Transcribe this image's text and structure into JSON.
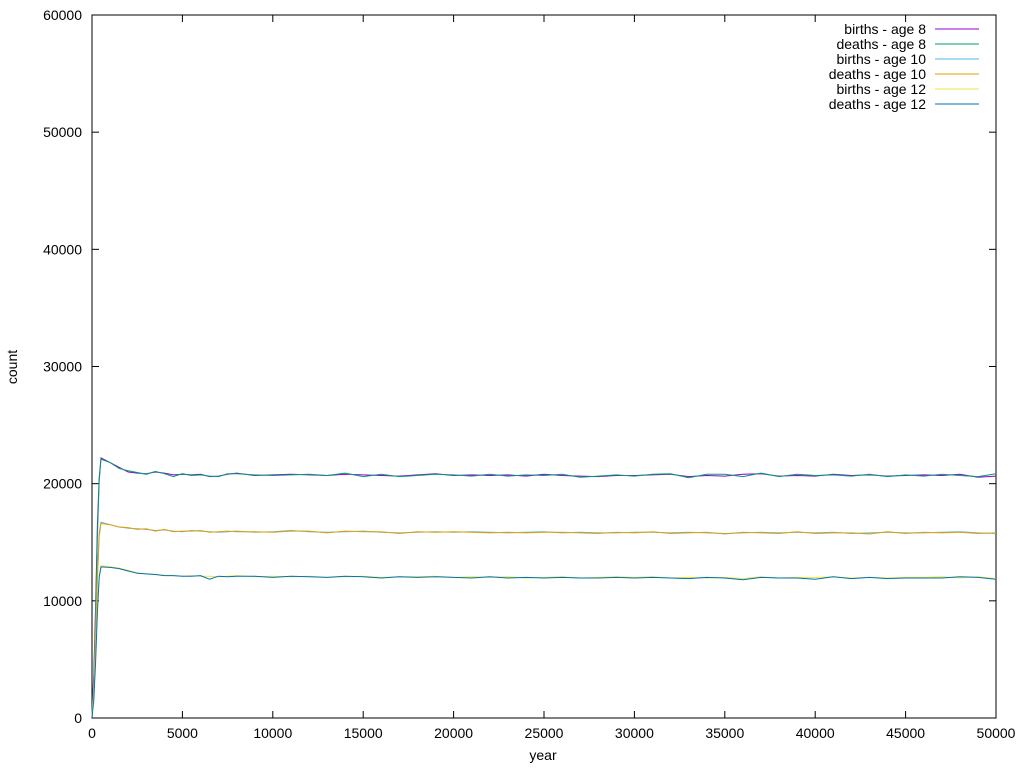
{
  "chart_data": {
    "type": "line",
    "title": "",
    "xlabel": "year",
    "ylabel": "count",
    "xlim": [
      0,
      50000
    ],
    "ylim": [
      0,
      60000
    ],
    "x_ticks": [
      0,
      5000,
      10000,
      15000,
      20000,
      25000,
      30000,
      35000,
      40000,
      45000,
      50000
    ],
    "y_ticks": [
      0,
      10000,
      20000,
      30000,
      40000,
      50000,
      60000
    ],
    "grid": false,
    "legend_position": "top-right",
    "x": [
      0,
      100,
      200,
      300,
      400,
      500,
      1000,
      1500,
      2000,
      2500,
      3000,
      3500,
      4000,
      4500,
      5000,
      5500,
      6000,
      6500,
      7000,
      7500,
      8000,
      9000,
      10000,
      11000,
      12000,
      13000,
      14000,
      15000,
      16000,
      17000,
      18000,
      19000,
      20000,
      21000,
      22000,
      23000,
      24000,
      25000,
      26000,
      27000,
      28000,
      29000,
      30000,
      31000,
      32000,
      33000,
      34000,
      35000,
      36000,
      37000,
      38000,
      39000,
      40000,
      41000,
      42000,
      43000,
      44000,
      45000,
      46000,
      47000,
      48000,
      49000,
      50000
    ],
    "series": [
      {
        "name": "births - age 8",
        "color": "#9400d3",
        "values": [
          200,
          3800,
          9500,
          16500,
          20500,
          22200,
          21800,
          21400,
          21000,
          20900,
          20850,
          21000,
          20900,
          20750,
          20800,
          20750,
          20800,
          20600,
          20650,
          20800,
          20900,
          20700,
          20750,
          20800,
          20750,
          20700,
          20800,
          20750,
          20700,
          20650,
          20750,
          20850,
          20700,
          20750,
          20700,
          20750,
          20650,
          20800,
          20700,
          20650,
          20600,
          20700,
          20700,
          20750,
          20800,
          20600,
          20700,
          20650,
          20800,
          20850,
          20650,
          20700,
          20650,
          20800,
          20700,
          20750,
          20650,
          20700,
          20750,
          20700,
          20800,
          20550,
          20650
        ]
      },
      {
        "name": "deaths - age 8",
        "color": "#009e73",
        "values": [
          100,
          3000,
          8500,
          15500,
          20200,
          22100,
          21800,
          21300,
          21100,
          20950,
          20800,
          21050,
          20850,
          20600,
          20850,
          20700,
          20750,
          20650,
          20600,
          20850,
          20850,
          20750,
          20700,
          20750,
          20800,
          20700,
          20900,
          20600,
          20800,
          20600,
          20700,
          20800,
          20750,
          20650,
          20800,
          20650,
          20750,
          20700,
          20800,
          20550,
          20650,
          20750,
          20650,
          20800,
          20850,
          20500,
          20800,
          20800,
          20600,
          20900,
          20600,
          20800,
          20700,
          20750,
          20650,
          20800,
          20600,
          20750,
          20650,
          20800,
          20700,
          20600,
          20850
        ]
      },
      {
        "name": "births - age 10",
        "color": "#56b4e9",
        "values": [
          150,
          2800,
          7500,
          12500,
          15800,
          16700,
          16500,
          16300,
          16200,
          16150,
          16100,
          16000,
          16050,
          15950,
          15900,
          16000,
          15950,
          15900,
          15850,
          15900,
          15950,
          15850,
          15900,
          16000,
          15900,
          15850,
          15900,
          15950,
          15850,
          15800,
          15850,
          15900,
          15850,
          15900,
          15850,
          15800,
          15850,
          15900,
          15800,
          15850,
          15800,
          15800,
          15850,
          15850,
          15800,
          15850,
          15800,
          15750,
          15800,
          15850,
          15800,
          15850,
          15800,
          15850,
          15750,
          15800,
          15850,
          15800,
          15800,
          15850,
          15900,
          15800,
          15750
        ]
      },
      {
        "name": "deaths - age 10",
        "color": "#e69f00",
        "values": [
          80,
          2200,
          6800,
          11800,
          15500,
          16600,
          16500,
          16300,
          16250,
          16100,
          16150,
          15950,
          16100,
          15900,
          15950,
          15950,
          16000,
          15850,
          15900,
          15950,
          15900,
          15900,
          15850,
          15950,
          15950,
          15800,
          15950,
          15900,
          15900,
          15750,
          15900,
          15850,
          15900,
          15850,
          15800,
          15850,
          15800,
          15850,
          15850,
          15800,
          15750,
          15850,
          15800,
          15900,
          15750,
          15800,
          15850,
          15700,
          15850,
          15800,
          15750,
          15900,
          15750,
          15800,
          15800,
          15700,
          15900,
          15750,
          15850,
          15800,
          15850,
          15750,
          15800
        ]
      },
      {
        "name": "births - age 12",
        "color": "#f0e442",
        "values": [
          100,
          1800,
          5200,
          9500,
          12200,
          13000,
          12900,
          12800,
          12600,
          12400,
          12300,
          12250,
          12200,
          12150,
          12100,
          12150,
          12100,
          12100,
          12050,
          12100,
          12150,
          12050,
          12100,
          12050,
          12100,
          12000,
          12050,
          12100,
          12000,
          12050,
          12050,
          12100,
          12000,
          12050,
          12000,
          12050,
          11950,
          12000,
          12050,
          11950,
          12000,
          12050,
          12000,
          12050,
          11950,
          12000,
          11950,
          12000,
          11900,
          12050,
          11950,
          12000,
          12000,
          12050,
          11950,
          12000,
          11950,
          12000,
          12000,
          12050,
          11950,
          12050,
          11900
        ]
      },
      {
        "name": "deaths - age 12",
        "color": "#0072b2",
        "values": [
          60,
          1500,
          4800,
          9000,
          12000,
          12900,
          12850,
          12750,
          12550,
          12350,
          12300,
          12250,
          12150,
          12150,
          12100,
          12100,
          12150,
          11850,
          12100,
          12050,
          12100,
          12100,
          12000,
          12100,
          12050,
          12000,
          12100,
          12050,
          11950,
          12050,
          12000,
          12050,
          12000,
          11950,
          12050,
          11950,
          12000,
          11950,
          12000,
          11950,
          11950,
          12000,
          11950,
          12000,
          11950,
          11900,
          12000,
          11950,
          11800,
          12000,
          11950,
          11950,
          11850,
          12050,
          11900,
          12000,
          11900,
          11950,
          11950,
          11950,
          12050,
          12000,
          11850
        ]
      }
    ]
  }
}
